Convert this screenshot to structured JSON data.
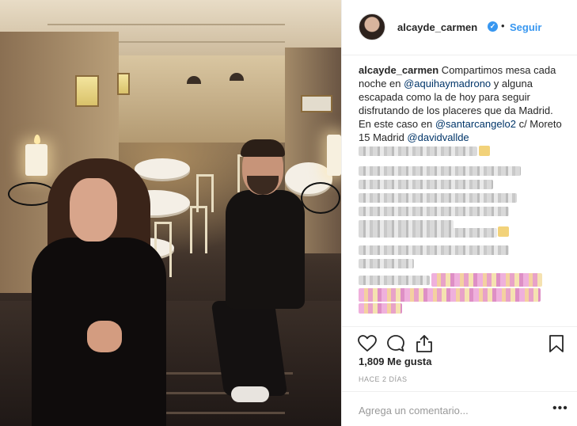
{
  "post": {
    "username": "alcayde_carmen",
    "verified_symbol": "✓",
    "separator": "•",
    "follow_label": "Seguir"
  },
  "caption": {
    "user": "alcayde_carmen",
    "text_1": " Compartimos mesa cada noche en ",
    "mention_1": "@aquihaymadrono",
    "text_2": " y alguna escapada como la de hoy para seguir disfrutando de los placeres que da Madrid. En este caso en ",
    "mention_2": "@santarcangelo2",
    "text_3": " c/ Moreto 15 Madrid ",
    "mention_3": "@davidvallde"
  },
  "stats": {
    "likes": "1,809 Me gusta",
    "timestamp": "HACE 2 DÍAS"
  },
  "comment": {
    "placeholder": "Agrega un comentario...",
    "more_label": "•••"
  },
  "icons": {
    "like": "heart-icon",
    "comment": "comment-icon",
    "share": "share-icon",
    "save": "bookmark-icon",
    "verified": "verified-badge-icon"
  },
  "colors": {
    "accent": "#3897f0",
    "mention": "#003569",
    "muted": "#999999",
    "border": "#efefef"
  }
}
